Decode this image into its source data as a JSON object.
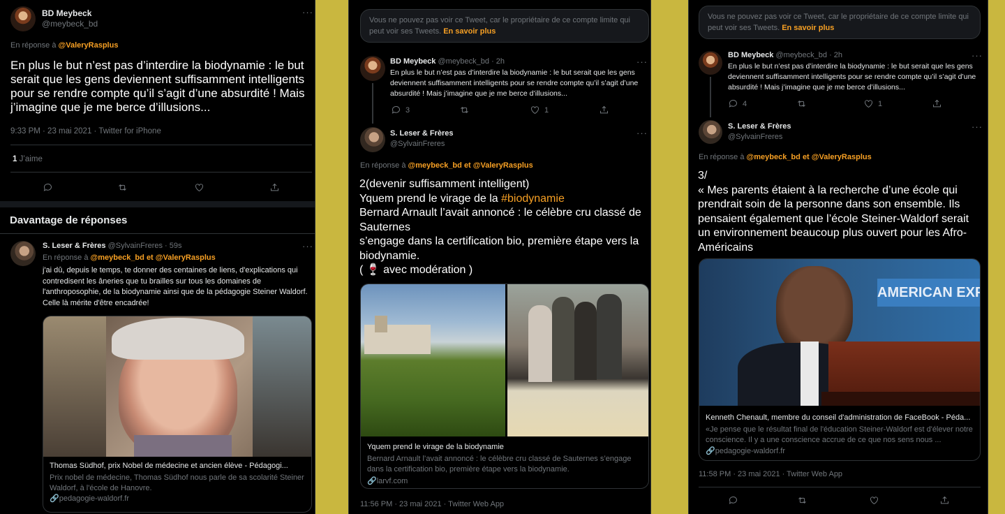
{
  "colors": {
    "accent": "#f7a024",
    "background": "#000000",
    "page_bg": "#c9b73f",
    "text": "#e7e9ea",
    "muted": "#71767b"
  },
  "col1": {
    "author_name": "BD Meybeck",
    "author_handle": "@meybeck_bd",
    "reply_prefix": "En réponse à",
    "reply_to": "@ValeryRasplus",
    "tweet_text": "En plus le but n’est pas d’interdire la biodynamie : le but serait que les gens deviennent suffisamment intelligents pour se rendre compte qu’il s’agit d’une absurdité ! Mais j’imagine que je me berce d’illusions...",
    "timestamp": "9:33 PM · 23 mai 2021 · Twitter for iPhone",
    "likes_count": "1",
    "likes_label": "J’aime",
    "more_replies": "Davantage de réponses",
    "reply": {
      "author_name": "S. Leser & Frères",
      "author_handle": "@SylvainFreres",
      "time": "· 59s",
      "reply_prefix": "En réponse à",
      "reply_to_1": "@meybeck_bd",
      "and": "et",
      "reply_to_2": "@ValeryRasplus",
      "text": "j'ai dû, depuis le temps, te donner des centaines de liens, d'explications qui contredisent les âneries que tu brailles sur tous les domaines de l'anthroposophie, de la biodynamie ainsi que de la pédagogie Steiner Waldorf. Celle là mérite d'être encadrée!",
      "card_title": "Thomas Südhof, prix Nobel de médecine et ancien élève - Pédagogi...",
      "card_desc": "Prix nobel de médecine, Thomas Südhof nous parle de sa scolarité Steiner Waldorf, à l'école de Hanovre.",
      "card_link": "pedagogie-waldorf.fr"
    }
  },
  "col2": {
    "notice_text": "Vous ne pouvez pas voir ce Tweet, car le propriétaire de ce compte limite qui peut voir ses Tweets.",
    "notice_link": "En savoir plus",
    "parent": {
      "author_name": "BD Meybeck",
      "author_handle": "@meybeck_bd · 2h",
      "text": "En plus le but n’est pas d’interdire la biodynamie : le but serait que les gens deviennent suffisamment intelligents pour se rendre compte qu’il s’agit d’une absurdité ! Mais j’imagine que je me berce d’illusions...",
      "replies": "3",
      "likes": "1"
    },
    "author_name": "S. Leser & Frères",
    "author_handle": "@SylvainFreres",
    "reply_prefix": "En réponse à",
    "reply_to_1": "@meybeck_bd",
    "and": "et",
    "reply_to_2": "@ValeryRasplus",
    "line1": "2(devenir suffisamment intelligent)",
    "line2a": "Yquem prend le virage de la ",
    "hashtag": "#biodynamie",
    "line3": "Bernard Arnault l’avait annoncé : le célèbre cru classé de Sauternes",
    "line4": "s’engage dans la certification bio, première étape vers la biodynamie.",
    "line5": "( 🍷 avec modération )",
    "card_title": "Yquem prend le virage de la biodynamie",
    "card_desc": "Bernard Arnault l’avait annoncé : le célèbre cru classé de Sauternes s’engage dans la certification bio, première étape vers la biodynamie.",
    "card_link": "larvf.com",
    "timestamp": "11:56 PM · 23 mai 2021 · Twitter Web App"
  },
  "col3": {
    "notice_text": "Vous ne pouvez pas voir ce Tweet, car le propriétaire de ce compte limite qui peut voir ses Tweets.",
    "notice_link": "En savoir plus",
    "parent": {
      "author_name": "BD Meybeck",
      "author_handle": "@meybeck_bd · 2h",
      "text": "En plus le but n’est pas d’interdire la biodynamie : le but serait que les gens deviennent suffisamment intelligents pour se rendre compte qu’il s’agit d’une absurdité ! Mais j’imagine que je me berce d’illusions...",
      "replies": "4",
      "likes": "1"
    },
    "author_name": "S. Leser & Frères",
    "author_handle": "@SylvainFreres",
    "reply_prefix": "En réponse à",
    "reply_to_1": "@meybeck_bd",
    "and": "et",
    "reply_to_2": "@ValeryRasplus",
    "text": "3/\n« Mes parents étaient à la recherche d’une école qui prendrait soin de la personne dans son ensemble. Ils pensaient également que l’école Steiner-Waldorf serait un environnement beaucoup plus ouvert pour les Afro-Américains",
    "card_sign_text": "AMERICAN EXPRESS",
    "card_title": "Kenneth Chenault, membre du conseil d'administration de FaceBook - Péda...",
    "card_desc": "«Je pense que le résultat final de l'éducation Steiner-Waldorf est d'élever notre conscience. Il y a une conscience accrue de ce que nos sens nous ...",
    "card_link": "pedagogie-waldorf.fr",
    "timestamp": "11:58 PM · 23 mai 2021 · Twitter Web App"
  }
}
